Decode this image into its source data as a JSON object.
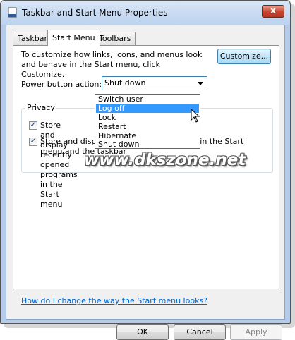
{
  "window": {
    "title": "Taskbar and Start Menu Properties",
    "close_label": "x"
  },
  "tabs": [
    {
      "label": "Taskbar",
      "active": false
    },
    {
      "label": "Start Menu",
      "active": true
    },
    {
      "label": "Toolbars",
      "active": false
    }
  ],
  "start_menu": {
    "description": "To customize how links, icons, and menus look and behave in the Start menu, click Customize.",
    "customize_label": "Customize...",
    "power_label": "Power button action:",
    "power_value": "Shut down",
    "dropdown_options": [
      "Switch user",
      "Log off",
      "Lock",
      "Restart",
      "Hibernate",
      "Shut down"
    ],
    "dropdown_highlighted": "Log off",
    "privacy": {
      "group_label": "Privacy",
      "option1": "Store and display recently opened programs in the Start menu",
      "option1_checked": true,
      "option2": "Store and display recently opened items in the Start menu and the taskbar",
      "option2_checked": true
    },
    "help_link": "How do I change the way the Start menu looks?"
  },
  "watermark": "www.dkszone.net",
  "buttons": {
    "ok": "OK",
    "cancel": "Cancel",
    "apply": "Apply"
  },
  "colors": {
    "selection": "#3399ff",
    "link": "#0066cc",
    "close": "#c8442e"
  },
  "icons": [
    "taskbar-window-icon",
    "close-icon",
    "dropdown-arrow-icon",
    "mouse-cursor-icon"
  ]
}
